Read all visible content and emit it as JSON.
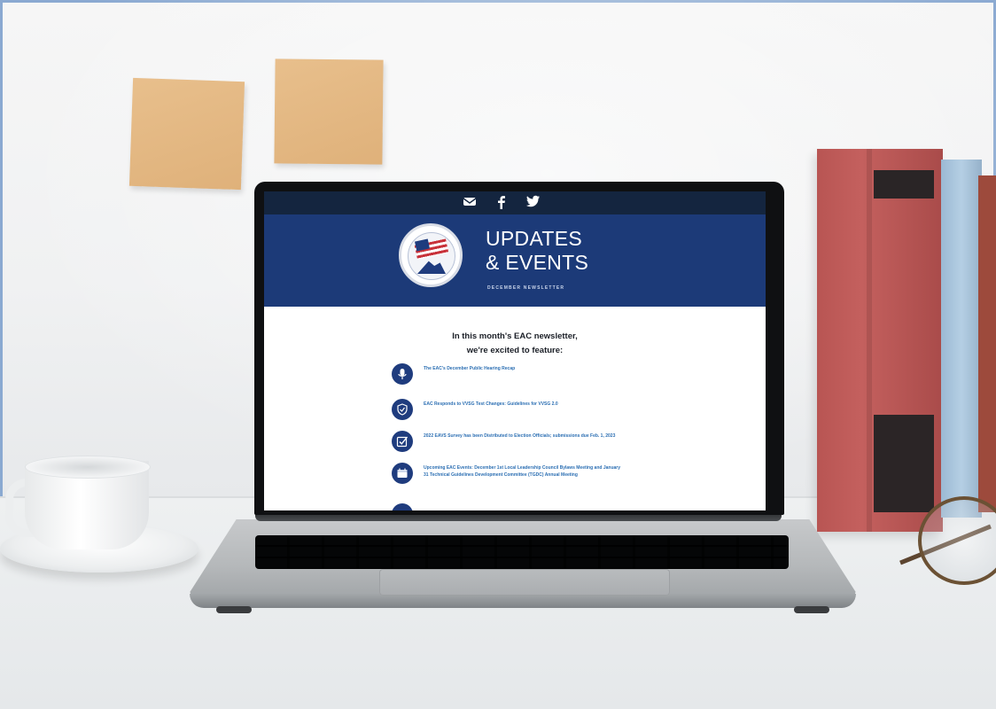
{
  "newsletter": {
    "title_line1": "UPDATES",
    "title_line2": "& EVENTS",
    "subtitle": "DECEMBER NEWSLETTER",
    "intro_line1": "In this month's EAC newsletter,",
    "intro_line2": "we're excited to feature:",
    "social_icons": [
      "email-icon",
      "facebook-icon",
      "twitter-icon"
    ],
    "items": [
      {
        "icon": "microphone-icon",
        "text": "The EAC's December Public Hearing Recap"
      },
      {
        "icon": "shield-check-icon",
        "text": "EAC Responds to VVSG Test Changes: Guidelines for VVSG 2.0"
      },
      {
        "icon": "checkbox-icon",
        "text": "2022 EAVS Survey has been Distributed to Election Officials; submissions due Feb. 1, 2023"
      },
      {
        "icon": "calendar-icon",
        "text": "Upcoming EAC Events: December 1st Local Leadership Council Bylaws Meeting and January 31 Technical Guidelines Development Committee (TGDC) Annual Meeting"
      },
      {
        "icon": "info-icon",
        "text": ""
      }
    ]
  },
  "colors": {
    "navy": "#1c3a78",
    "top_strip": "#14253f",
    "link_blue": "#2c6fb3",
    "sticky_note": "#e2b57f",
    "red_book": "#b85553",
    "blue_book": "#a9c5dc"
  }
}
